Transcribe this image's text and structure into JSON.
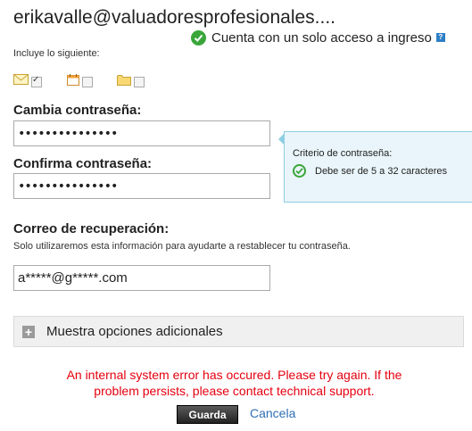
{
  "account": {
    "email": "erikavalle@valuadoresprofesionales....",
    "single_access_label": "Cuenta con un solo acceso a ingreso",
    "help_glyph": "?"
  },
  "include": {
    "label": "Incluye lo siguiente:",
    "items": [
      {
        "icon": "mail-icon",
        "checked": true
      },
      {
        "icon": "calendar-icon",
        "checked": false
      },
      {
        "icon": "folder-icon",
        "checked": false
      }
    ]
  },
  "password": {
    "change_label": "Cambia contraseña:",
    "change_value": "•••••••••••••••",
    "confirm_label": "Confirma contraseña:",
    "confirm_value": "•••••••••••••••"
  },
  "tooltip": {
    "title": "Criterio de contraseña:",
    "rule": "Debe ser de 5 a 32 caracteres"
  },
  "recovery": {
    "label": "Correo de recuperación:",
    "hint": "Solo utilizaremos esta información para ayudarte a restablecer tu contraseña.",
    "value": "a*****@g*****.com"
  },
  "more_options": {
    "label": "Muestra opciones adicionales",
    "glyph": "+"
  },
  "error": {
    "line1": "An internal system error has occured. Please try again. If the",
    "line2": "problem persists, please contact technical support."
  },
  "actions": {
    "save_label": "Guarda",
    "cancel_label": "Cancela"
  },
  "colors": {
    "error": "#e4000f",
    "link": "#2f6fb4",
    "success": "#3aa63a",
    "tooltip_bg": "#e9f5fa"
  }
}
